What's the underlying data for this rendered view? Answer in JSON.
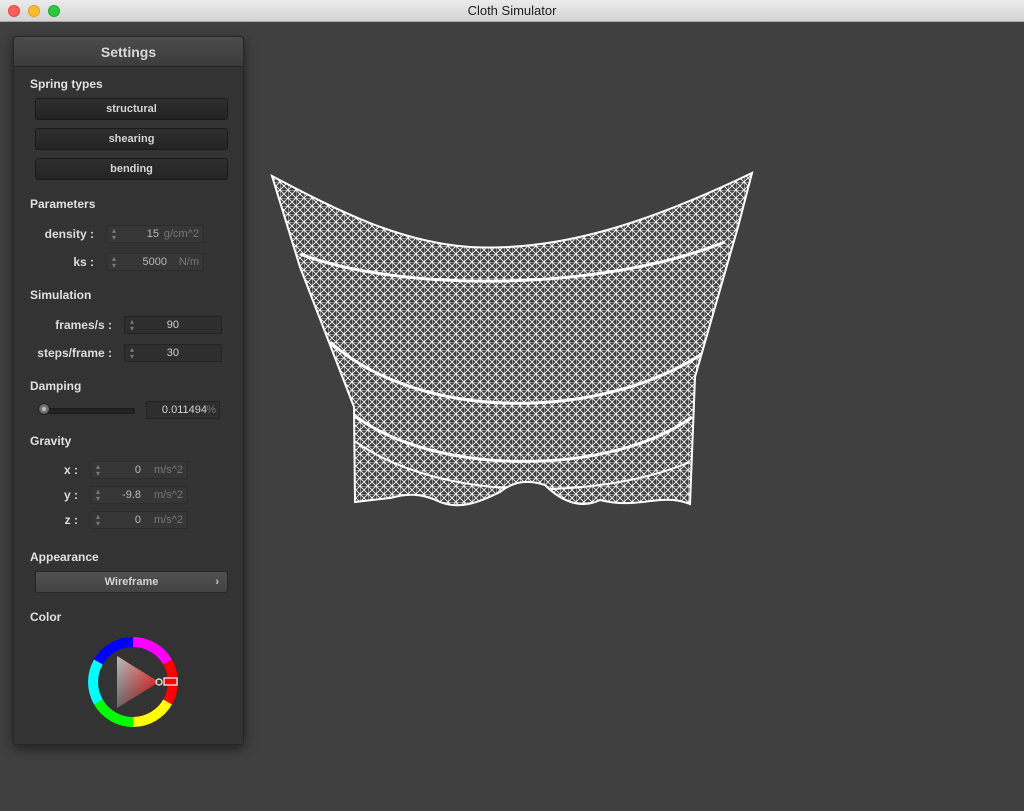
{
  "window": {
    "title": "Cloth Simulator"
  },
  "panel": {
    "title": "Settings",
    "spring_types": {
      "label": "Spring types",
      "buttons": [
        "structural",
        "shearing",
        "bending"
      ]
    },
    "parameters": {
      "label": "Parameters",
      "density": {
        "label": "density :",
        "value": "15",
        "unit": "g/cm^2"
      },
      "ks": {
        "label": "ks :",
        "value": "5000",
        "unit": "N/m"
      }
    },
    "simulation": {
      "label": "Simulation",
      "fps": {
        "label": "frames/s :",
        "value": "90"
      },
      "steps": {
        "label": "steps/frame :",
        "value": "30"
      }
    },
    "damping": {
      "label": "Damping",
      "value": "0.011494",
      "unit": "%",
      "slider_fraction": 0.011
    },
    "gravity": {
      "label": "Gravity",
      "x": {
        "label": "x :",
        "value": "0",
        "unit": "m/s^2"
      },
      "y": {
        "label": "y :",
        "value": "-9.8",
        "unit": "m/s^2"
      },
      "z": {
        "label": "z :",
        "value": "0",
        "unit": "m/s^2"
      }
    },
    "appearance": {
      "label": "Appearance",
      "selected": "Wireframe"
    },
    "color": {
      "label": "Color",
      "selected_hex": "#ff0000"
    }
  },
  "viewport": {
    "background": "#404040",
    "cloth_color": "#ffffff",
    "render_mode": "wireframe"
  }
}
